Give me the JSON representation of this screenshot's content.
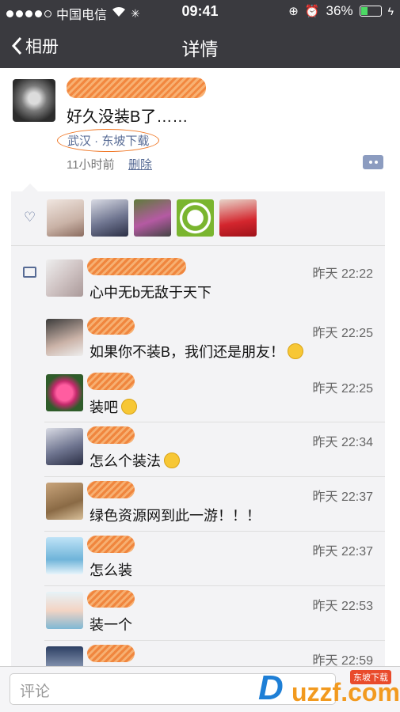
{
  "status_bar": {
    "carrier": "中国电信",
    "time": "09:41",
    "battery": "36%",
    "battery_level": 0.36
  },
  "nav": {
    "back_label": "相册",
    "title": "详情"
  },
  "post": {
    "text": "好久没装B了……",
    "location": "武汉 · 东坡下载",
    "time": "11小时前",
    "delete_label": "删除"
  },
  "comments": [
    {
      "time": "昨天 22:22",
      "text": "心中无b无敌于天下",
      "emoji": false
    },
    {
      "time": "昨天 22:25",
      "text": "如果你不装B，我们还是朋友！",
      "emoji": true
    },
    {
      "time": "昨天 22:25",
      "text": "装吧",
      "emoji": true
    },
    {
      "time": "昨天 22:34",
      "text": "怎么个装法",
      "emoji": true
    },
    {
      "time": "昨天 22:37",
      "text": "绿色资源网到此一游！！！",
      "emoji": false
    },
    {
      "time": "昨天 22:37",
      "text": "怎么装",
      "emoji": false
    },
    {
      "time": "昨天 22:53",
      "text": "装一个",
      "emoji": false
    },
    {
      "time": "昨天 22:59",
      "text": "",
      "emoji": false
    }
  ],
  "input": {
    "placeholder": "评论"
  },
  "watermark": {
    "brand": "uzzf.com",
    "tag": "东坡下载"
  },
  "colors": {
    "nav_bg": "#3a3a3f",
    "link": "#576b95"
  }
}
